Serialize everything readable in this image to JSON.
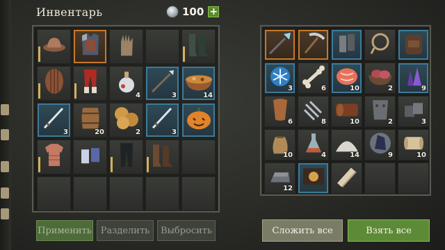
{
  "header": {
    "title": "Инвентарь",
    "coins": "100",
    "plus": "+"
  },
  "inventory": {
    "slots": [
      {
        "icon": "helmet-icon",
        "qty": "",
        "frame": "",
        "dur": "full"
      },
      {
        "icon": "chest-armor-icon",
        "qty": "",
        "frame": "orange",
        "dur": ""
      },
      {
        "icon": "gloves-icon",
        "qty": "",
        "frame": "",
        "dur": ""
      },
      {
        "icon": "",
        "qty": "",
        "frame": "",
        "dur": ""
      },
      {
        "icon": "boots-icon",
        "qty": "",
        "frame": "",
        "dur": "full"
      },
      {
        "icon": "wooden-shield-icon",
        "qty": "",
        "frame": "",
        "dur": "full"
      },
      {
        "icon": "red-pants-icon",
        "qty": "",
        "frame": "",
        "dur": "full"
      },
      {
        "icon": "potion-icon",
        "qty": "4",
        "frame": "",
        "dur": ""
      },
      {
        "icon": "spear-icon",
        "qty": "3",
        "frame": "blue",
        "dur": ""
      },
      {
        "icon": "stew-bowl-icon",
        "qty": "14",
        "frame": "blue",
        "dur": ""
      },
      {
        "icon": "sword-icon",
        "qty": "3",
        "frame": "blue",
        "dur": ""
      },
      {
        "icon": "barrel-icon",
        "qty": "20",
        "frame": "",
        "dur": ""
      },
      {
        "icon": "cookies-icon",
        "qty": "2",
        "frame": "",
        "dur": ""
      },
      {
        "icon": "sword-icon",
        "qty": "3",
        "frame": "blue",
        "dur": ""
      },
      {
        "icon": "pumpkin-icon",
        "qty": "",
        "frame": "blue",
        "dur": ""
      },
      {
        "icon": "tunic-icon",
        "qty": "",
        "frame": "",
        "dur": "full"
      },
      {
        "icon": "gauntlets-icon",
        "qty": "",
        "frame": "",
        "dur": ""
      },
      {
        "icon": "dark-pants-icon",
        "qty": "",
        "frame": "",
        "dur": "full"
      },
      {
        "icon": "leather-boots-icon",
        "qty": "",
        "frame": "",
        "dur": "full"
      },
      {
        "icon": "",
        "qty": "",
        "frame": "",
        "dur": ""
      },
      {
        "icon": "",
        "qty": "",
        "frame": "",
        "dur": ""
      },
      {
        "icon": "",
        "qty": "",
        "frame": "",
        "dur": ""
      },
      {
        "icon": "",
        "qty": "",
        "frame": "",
        "dur": ""
      },
      {
        "icon": "",
        "qty": "",
        "frame": "",
        "dur": ""
      },
      {
        "icon": "",
        "qty": "",
        "frame": "",
        "dur": ""
      }
    ]
  },
  "loot": {
    "slots": [
      {
        "icon": "ice-spear-icon",
        "qty": "",
        "frame": "orange"
      },
      {
        "icon": "pickaxe-icon",
        "qty": "",
        "frame": "orange"
      },
      {
        "icon": "bracers-icon",
        "qty": "",
        "frame": "blue"
      },
      {
        "icon": "rope-icon",
        "qty": "",
        "frame": ""
      },
      {
        "icon": "backpack-icon",
        "qty": "",
        "frame": "blue"
      },
      {
        "icon": "frost-orb-icon",
        "qty": "3",
        "frame": "blue"
      },
      {
        "icon": "bone-icon",
        "qty": "6",
        "frame": ""
      },
      {
        "icon": "salmon-steak-icon",
        "qty": "10",
        "frame": "blue"
      },
      {
        "icon": "meat-bowl-icon",
        "qty": "2",
        "frame": ""
      },
      {
        "icon": "crystal-shards-icon",
        "qty": "9",
        "frame": "blue"
      },
      {
        "icon": "leather-icon",
        "qty": "6",
        "frame": ""
      },
      {
        "icon": "nails-icon",
        "qty": "8",
        "frame": ""
      },
      {
        "icon": "leather-roll-icon",
        "qty": "10",
        "frame": ""
      },
      {
        "icon": "iron-plate-icon",
        "qty": "2",
        "frame": ""
      },
      {
        "icon": "iron-parts-icon",
        "qty": "3",
        "frame": ""
      },
      {
        "icon": "sack-icon",
        "qty": "10",
        "frame": ""
      },
      {
        "icon": "flask-icon",
        "qty": "4",
        "frame": ""
      },
      {
        "icon": "salt-pile-icon",
        "qty": "14",
        "frame": ""
      },
      {
        "icon": "dark-crystal-icon",
        "qty": "9",
        "frame": ""
      },
      {
        "icon": "scroll-icon",
        "qty": "10",
        "frame": ""
      },
      {
        "icon": "iron-ingot-icon",
        "qty": "12",
        "frame": ""
      },
      {
        "icon": "recipe-book-icon",
        "qty": "",
        "frame": "blue"
      },
      {
        "icon": "bandage-roll-icon",
        "qty": "",
        "frame": ""
      },
      {
        "icon": "",
        "qty": "",
        "frame": ""
      },
      {
        "icon": "",
        "qty": "",
        "frame": ""
      }
    ]
  },
  "buttons": {
    "apply": "Применить",
    "split": "Разделить",
    "drop": "Выбросить",
    "stack_all": "Сложить все",
    "take_all": "Взять все"
  }
}
